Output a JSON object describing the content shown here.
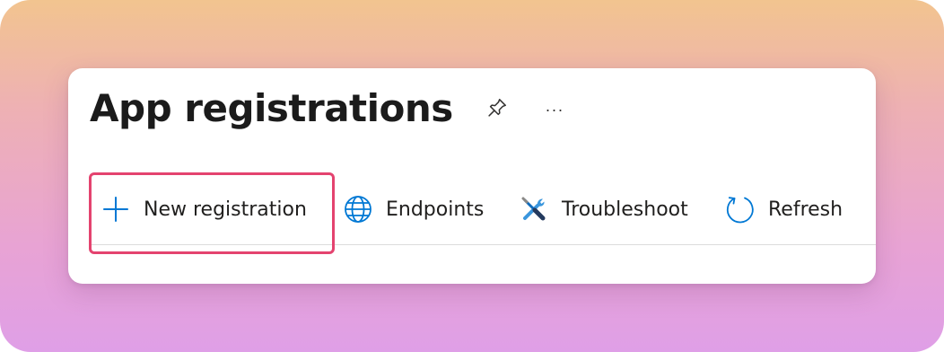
{
  "header": {
    "title": "App registrations",
    "pin_icon": "pin-icon",
    "more_label": "···"
  },
  "toolbar": {
    "items": [
      {
        "label": "New registration",
        "icon": "plus-icon"
      },
      {
        "label": "Endpoints",
        "icon": "globe-icon"
      },
      {
        "label": "Troubleshoot",
        "icon": "wrench-screwdriver-icon"
      },
      {
        "label": "Refresh",
        "icon": "refresh-icon"
      }
    ]
  },
  "colors": {
    "accent": "#0078d4",
    "highlight": "#e4436f",
    "text": "#201f1e"
  }
}
